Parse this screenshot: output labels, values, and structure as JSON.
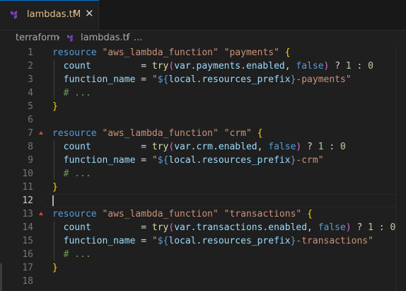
{
  "tab": {
    "filename": "lambdas.tf",
    "modified_marker": "M",
    "close_glyph": "✕",
    "icon": "terraform-icon"
  },
  "breadcrumb": {
    "folder": "terraform",
    "separator": "›",
    "file": "lambdas.tf",
    "separator2": "›",
    "ellipsis": "..."
  },
  "colors": {
    "background": "#1f1f1f",
    "keyword": "#569cd6",
    "string": "#ce9178",
    "attribute": "#9cdcfe",
    "comment": "#6a9955",
    "number": "#b5cea8",
    "function": "#dcdcaa",
    "modified": "#e2c08d"
  },
  "editor": {
    "active_line": 12,
    "lines": [
      {
        "n": "1",
        "tokens": [
          [
            "kw",
            "resource"
          ],
          [
            "punc",
            " "
          ],
          [
            "str",
            "\"aws_lambda_function\""
          ],
          [
            "punc",
            " "
          ],
          [
            "str",
            "\"payments\""
          ],
          [
            "punc",
            " "
          ],
          [
            "b1",
            "{"
          ]
        ]
      },
      {
        "n": "2",
        "tokens": [
          [
            "punc",
            "  "
          ],
          [
            "attr",
            "count"
          ],
          [
            "punc",
            "         = "
          ],
          [
            "fn",
            "try"
          ],
          [
            "b2",
            "("
          ],
          [
            "attr",
            "var.payments.enabled"
          ],
          [
            "punc",
            ", "
          ],
          [
            "kw",
            "false"
          ],
          [
            "b2",
            ")"
          ],
          [
            "punc",
            " ? "
          ],
          [
            "num",
            "1"
          ],
          [
            "punc",
            " : "
          ],
          [
            "num",
            "0"
          ]
        ]
      },
      {
        "n": "3",
        "tokens": [
          [
            "punc",
            "  "
          ],
          [
            "attr",
            "function_name"
          ],
          [
            "punc",
            " = "
          ],
          [
            "str",
            "\""
          ],
          [
            "kw",
            "${"
          ],
          [
            "attr",
            "local.resources_prefix"
          ],
          [
            "kw",
            "}"
          ],
          [
            "str",
            "-payments\""
          ]
        ]
      },
      {
        "n": "4",
        "tokens": [
          [
            "punc",
            "  "
          ],
          [
            "cmt",
            "# ..."
          ]
        ]
      },
      {
        "n": "5",
        "tokens": [
          [
            "b1",
            "}"
          ]
        ]
      },
      {
        "n": "6",
        "tokens": []
      },
      {
        "n": "7",
        "tokens": [
          [
            "kw",
            "resource"
          ],
          [
            "punc",
            " "
          ],
          [
            "str",
            "\"aws_lambda_function\""
          ],
          [
            "punc",
            " "
          ],
          [
            "str",
            "\"crm\""
          ],
          [
            "punc",
            " "
          ],
          [
            "b1",
            "{"
          ]
        ]
      },
      {
        "n": "8",
        "tokens": [
          [
            "punc",
            "  "
          ],
          [
            "attr",
            "count"
          ],
          [
            "punc",
            "         = "
          ],
          [
            "fn",
            "try"
          ],
          [
            "b2",
            "("
          ],
          [
            "attr",
            "var.crm.enabled"
          ],
          [
            "punc",
            ", "
          ],
          [
            "kw",
            "false"
          ],
          [
            "b2",
            ")"
          ],
          [
            "punc",
            " ? "
          ],
          [
            "num",
            "1"
          ],
          [
            "punc",
            " : "
          ],
          [
            "num",
            "0"
          ]
        ]
      },
      {
        "n": "9",
        "tokens": [
          [
            "punc",
            "  "
          ],
          [
            "attr",
            "function_name"
          ],
          [
            "punc",
            " = "
          ],
          [
            "str",
            "\""
          ],
          [
            "kw",
            "${"
          ],
          [
            "attr",
            "local.resources_prefix"
          ],
          [
            "kw",
            "}"
          ],
          [
            "str",
            "-crm\""
          ]
        ]
      },
      {
        "n": "10",
        "tokens": [
          [
            "punc",
            "  "
          ],
          [
            "cmt",
            "# ..."
          ]
        ]
      },
      {
        "n": "11",
        "tokens": [
          [
            "b1",
            "}"
          ]
        ]
      },
      {
        "n": "12",
        "tokens": []
      },
      {
        "n": "13",
        "tokens": [
          [
            "kw",
            "resource"
          ],
          [
            "punc",
            " "
          ],
          [
            "str",
            "\"aws_lambda_function\""
          ],
          [
            "punc",
            " "
          ],
          [
            "str",
            "\"transactions\""
          ],
          [
            "punc",
            " "
          ],
          [
            "b1",
            "{"
          ]
        ]
      },
      {
        "n": "14",
        "tokens": [
          [
            "punc",
            "  "
          ],
          [
            "attr",
            "count"
          ],
          [
            "punc",
            "         = "
          ],
          [
            "fn",
            "try"
          ],
          [
            "b2",
            "("
          ],
          [
            "attr",
            "var.transactions.enabled"
          ],
          [
            "punc",
            ", "
          ],
          [
            "kw",
            "false"
          ],
          [
            "b2",
            ")"
          ],
          [
            "punc",
            " ? "
          ],
          [
            "num",
            "1"
          ],
          [
            "punc",
            " : "
          ],
          [
            "num",
            "0"
          ]
        ]
      },
      {
        "n": "15",
        "tokens": [
          [
            "punc",
            "  "
          ],
          [
            "attr",
            "function_name"
          ],
          [
            "punc",
            " = "
          ],
          [
            "str",
            "\""
          ],
          [
            "kw",
            "${"
          ],
          [
            "attr",
            "local.resources_prefix"
          ],
          [
            "kw",
            "}"
          ],
          [
            "str",
            "-transactions\""
          ]
        ]
      },
      {
        "n": "16",
        "tokens": [
          [
            "punc",
            "  "
          ],
          [
            "cmt",
            "# ..."
          ]
        ]
      },
      {
        "n": "17",
        "tokens": [
          [
            "b1",
            "}"
          ]
        ]
      },
      {
        "n": "18",
        "tokens": []
      }
    ]
  }
}
